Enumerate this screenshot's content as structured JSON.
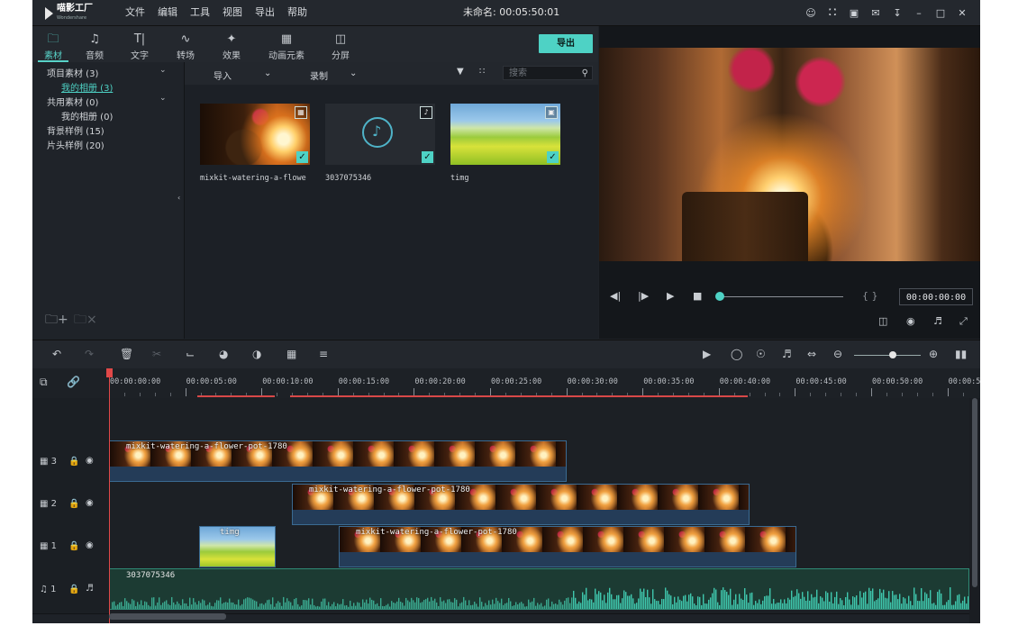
{
  "app": {
    "logo_text": "喵影工厂",
    "logo_sub": "Wondershare",
    "menu": [
      "文件",
      "编辑",
      "工具",
      "视图",
      "导出",
      "帮助"
    ],
    "project_title": "未命名: 00:05:50:01"
  },
  "tabs": [
    {
      "label": "素材",
      "icon": "folder-icon",
      "active": true
    },
    {
      "label": "音频",
      "icon": "music-note-icon"
    },
    {
      "label": "文字",
      "icon": "text-icon"
    },
    {
      "label": "转场",
      "icon": "transition-icon"
    },
    {
      "label": "效果",
      "icon": "effects-icon"
    },
    {
      "label": "动画元素",
      "icon": "image-element-icon"
    },
    {
      "label": "分屏",
      "icon": "split-screen-icon"
    }
  ],
  "export_label": "导出",
  "media_tree": [
    {
      "label": "项目素材 (3)",
      "expandable": true
    },
    {
      "label": "我的相册 (3)",
      "selected": true
    },
    {
      "label": "共用素材 (0)",
      "expandable": true
    },
    {
      "label": "我的相册 (0)"
    },
    {
      "label": "背景样例 (15)"
    },
    {
      "label": "片头样例 (20)"
    }
  ],
  "media_bar": {
    "import": "导入",
    "record": "录制",
    "search_placeholder": "搜索"
  },
  "media_items": [
    {
      "name": "mixkit-watering-a-flowe",
      "type": "video",
      "checked": true
    },
    {
      "name": "3037075346",
      "type": "audio",
      "checked": true
    },
    {
      "name": "timg",
      "type": "image",
      "checked": true
    }
  ],
  "preview": {
    "timecode": "00:00:00:00",
    "progress": 0.0
  },
  "ruler_ticks": [
    "00:00:00:00",
    "00:00:05:00",
    "00:00:10:00",
    "00:00:15:00",
    "00:00:20:00",
    "00:00:25:00",
    "00:00:30:00",
    "00:00:35:00",
    "00:00:40:00",
    "00:00:45:00",
    "00:00:50:00",
    "00:00:5"
  ],
  "tracks": [
    {
      "label": "3",
      "type": "video",
      "clips": [
        {
          "name": "mixkit-watering-a-flower-pot-1780",
          "start": 0,
          "end": 30
        }
      ]
    },
    {
      "label": "2",
      "type": "video",
      "clips": [
        {
          "name": "mixkit-watering-a-flower-pot-1780",
          "start": 12,
          "end": 42
        }
      ]
    },
    {
      "label": "1",
      "type": "video",
      "clips": [
        {
          "name": "timg",
          "start": 6,
          "end": 11
        },
        {
          "name": "mixkit-watering-a-flower-pot-1780",
          "start": 15,
          "end": 45
        }
      ]
    },
    {
      "label": "1",
      "type": "audio",
      "clips": [
        {
          "name": "3037075346",
          "start": 0,
          "end": 56
        }
      ]
    }
  ],
  "colors": {
    "accent": "#4ed2c5",
    "playhead": "#e04848",
    "bg": "#1e2228"
  }
}
